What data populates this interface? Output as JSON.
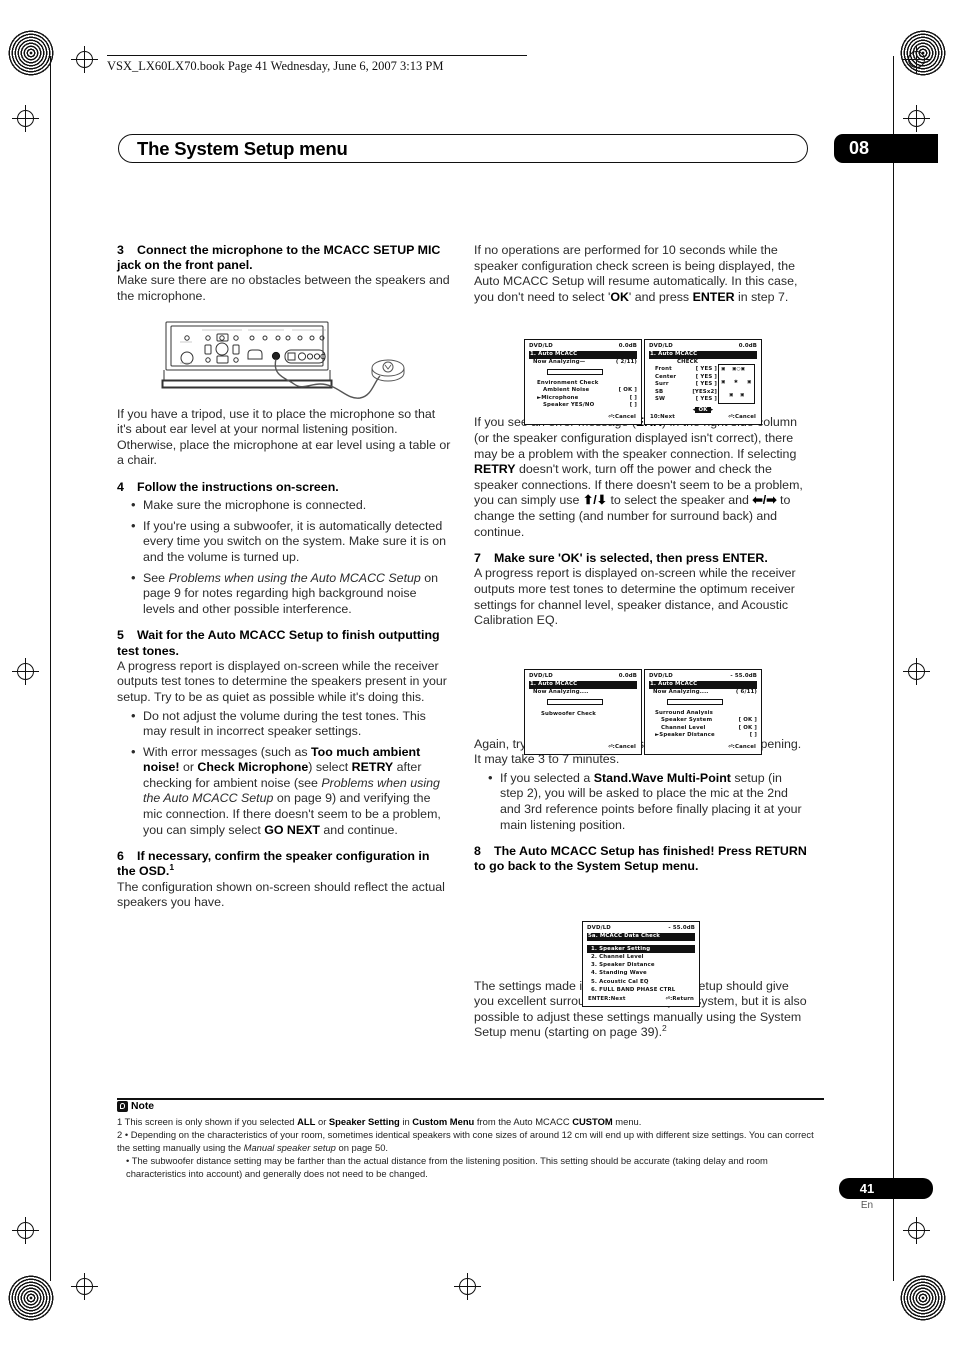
{
  "header": {
    "running_head": "VSX_LX60LX70.book  Page 41  Wednesday, June 6, 2007  3:13 PM",
    "chapter_title": "The System Setup menu",
    "chapter_number": "08"
  },
  "left_column": {
    "step3": {
      "num": "3",
      "heading": "Connect the microphone to the MCACC SETUP MIC jack on the front panel.",
      "body": "Make sure there are no obstacles between the speakers and the microphone.",
      "after_figure": "If you have a tripod, use it to place the microphone so that it's about ear level at your normal listening position. Otherwise, place the microphone at ear level using a table or a chair."
    },
    "step4": {
      "num": "4",
      "heading": "Follow the instructions on-screen.",
      "bullets": [
        "Make sure the microphone is connected.",
        "If you're using a subwoofer, it is automatically detected every time you switch on the system. Make sure it is on and the volume is turned up.",
        "See Problems when using the Auto MCACC Setup on page 9 for notes regarding high background noise levels and other possible interference."
      ]
    },
    "step5": {
      "num": "5",
      "heading": "Wait for the Auto MCACC Setup to finish outputting test tones.",
      "body": "A progress report is displayed on-screen while the receiver outputs test tones to determine the speakers present in your setup. Try to be as quiet as possible while it's doing this.",
      "bullets": [
        "Do not adjust the volume during the test tones. This may result in incorrect speaker settings.",
        "With error messages (such as Too much ambient noise! or Check Microphone) select RETRY after checking for ambient noise (see Problems when using the Auto MCACC Setup on page 9) and verifying the mic connection. If there doesn't seem to be a problem, you can simply select GO NEXT and continue."
      ]
    },
    "step6": {
      "num": "6",
      "heading": "If necessary, confirm the speaker configuration in the OSD.",
      "heading_footnote": "1",
      "body": "The configuration shown on-screen should reflect the actual speakers you have."
    }
  },
  "right_column": {
    "intro": "If no operations are performed for 10 seconds while the speaker configuration check screen is being displayed, the Auto MCACC Setup will resume automatically. In this case, you don't need to select 'OK' and press ENTER in step 7.",
    "after_osd1": "If you see an error message (ERR) in the right side column (or the speaker configuration displayed isn't correct), there may be a problem with the speaker connection. If selecting RETRY doesn't work, turn off the power and check the speaker connections. If there doesn't seem to be a problem, you can simply use ↑/↓ to select the speaker and ←/→ to change the setting (and number for surround back) and continue.",
    "step7": {
      "num": "7",
      "heading": "Make sure 'OK' is selected, then press ENTER.",
      "body": "A progress report is displayed on-screen while the receiver outputs more test tones to determine the optimum receiver settings for channel level, speaker distance, and Acoustic Calibration EQ."
    },
    "after_osd2": "Again, try to be as quiet as possible while this is happening. It may take 3 to 7 minutes.",
    "after_osd2_bullet": "If you selected a Stand.Wave Multi-Point setup (in step 2), you will be asked to place the mic at the 2nd and 3rd reference points before finally placing it at your main listening position.",
    "step8": {
      "num": "8",
      "heading": "The Auto MCACC Setup has finished! Press RETURN to go back to the System Setup menu."
    },
    "closing": "The settings made in the Auto MCACC Setup should give you excellent surround sound from your system, but it is also possible to adjust these settings manually using the System Setup menu (starting on page 39).",
    "closing_footnote": "2"
  },
  "osd_screens": {
    "screen1": {
      "source": "DVD/LD",
      "level": "0.0dB",
      "title": "1. Auto MCACC",
      "status": "Now Analyzing—",
      "progress": "( 2/11)",
      "section": "Environment Check",
      "rows": [
        {
          "label": "Ambient Noise",
          "value": "[ OK ]",
          "cursor": false
        },
        {
          "label": "Microphone",
          "value": "[      ]",
          "cursor": true
        },
        {
          "label": "Speaker YES/NO",
          "value": "[      ]",
          "cursor": false
        }
      ],
      "cancel": ":Cancel"
    },
    "screen2": {
      "source": "DVD/LD",
      "level": "0.0dB",
      "title": "1. Auto MCACC",
      "column_header": "CHECK",
      "rows": [
        {
          "label": "Front",
          "value": "[ YES ]"
        },
        {
          "label": "Center",
          "value": "[ YES ]"
        },
        {
          "label": "Surr",
          "value": "[ YES ]"
        },
        {
          "label": "SB",
          "value": "[YESx2]"
        },
        {
          "label": "SW",
          "value": "[ YES ]"
        }
      ],
      "ok_button": "OK",
      "next": "10:Next",
      "cancel": ":Cancel"
    },
    "screen3": {
      "source": "DVD/LD",
      "level": "0.0dB",
      "title": "1. Auto MCACC",
      "status": "Now Analyzing....",
      "section": "Subwoofer Check",
      "cancel": ":Cancel"
    },
    "screen4": {
      "source": "DVD/LD",
      "level": "- 55.0dB",
      "title": "1. Auto MCACC",
      "status": "Now  Analyzing....",
      "progress": "( 6/11)",
      "section": "Surround Analysis",
      "rows": [
        {
          "label": "Speaker System",
          "value": "[ OK ]",
          "cursor": false
        },
        {
          "label": "Channel Level",
          "value": "[ OK ]",
          "cursor": false
        },
        {
          "label": "Speaker Distance",
          "value": "[      ]",
          "cursor": true
        }
      ],
      "cancel": ":Cancel"
    },
    "screen5": {
      "source": "DVD/LD",
      "level": "- 55.0dB",
      "title": "5a. MCACC Data Check",
      "items": [
        {
          "label": "1. Speaker Setting",
          "selected": true
        },
        {
          "label": "2. Channel Level",
          "selected": false
        },
        {
          "label": "3. Speaker Distance",
          "selected": false
        },
        {
          "label": "4. Standing Wave",
          "selected": false
        },
        {
          "label": "5. Acoustic Cal EQ",
          "selected": false
        },
        {
          "label": "6. FULL BAND PHASE CTRL",
          "selected": false
        }
      ],
      "enter": "ENTER:Next",
      "return": ":Return"
    }
  },
  "note": {
    "label": "Note",
    "footnote1": "1 This screen is only shown if you selected ALL or Speaker Setting in Custom Menu from the Auto MCACC CUSTOM menu.",
    "footnote2a": "2 • Depending on the characteristics of your room, sometimes identical speakers with cone sizes of around 12 cm will end up with different size settings. You can correct the setting manually using the Manual speaker setup on page 50.",
    "footnote2b": "• The subwoofer distance setting may be farther than the actual distance from the listening position. This setting should be accurate (taking delay and room characteristics into account) and generally does not need to be changed."
  },
  "footer": {
    "page_number": "41",
    "language": "En"
  }
}
